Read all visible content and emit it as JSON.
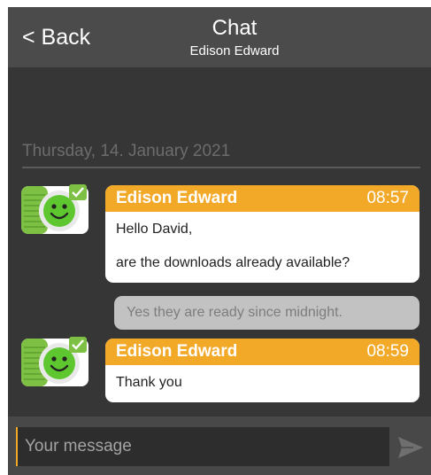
{
  "header": {
    "back_label": "< Back",
    "title": "Chat",
    "subtitle": "Edison Edward"
  },
  "date_separator": "Thursday, 14. January 2021",
  "messages": [
    {
      "direction": "incoming",
      "sender": "Edison Edward",
      "time": "08:57",
      "lines": [
        "Hello David,",
        "are the downloads already available?"
      ]
    },
    {
      "direction": "outgoing",
      "text": "Yes they are ready since midnight."
    },
    {
      "direction": "incoming",
      "sender": "Edison Edward",
      "time": "08:59",
      "lines": [
        "Thank you"
      ]
    }
  ],
  "composer": {
    "placeholder": "Your message",
    "send_icon": "send-arrow-icon"
  },
  "colors": {
    "background": "#363636",
    "header": "#4b4b4b",
    "accent": "#f3a928",
    "outgoing_bubble": "#c2c2c2",
    "avatar_green": "#7dc043"
  }
}
